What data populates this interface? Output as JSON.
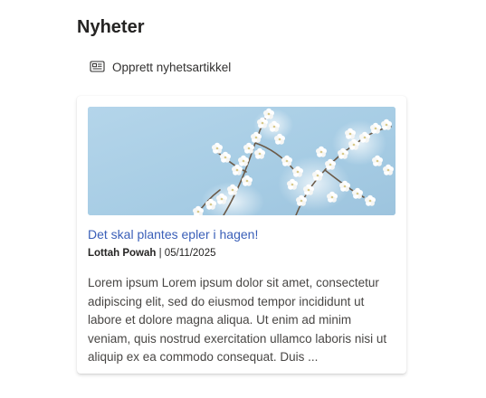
{
  "section": {
    "title": "Nyheter",
    "create_label": "Opprett nyhetsartikkel"
  },
  "card": {
    "image_alt": "Cherry blossoms",
    "title": "Det skal plantes epler i hagen!",
    "author": "Lottah Powah",
    "separator": "|",
    "date": "05/11/2025",
    "excerpt": "Lorem ipsum Lorem ipsum dolor sit amet, consectetur adipiscing elit, sed do eiusmod tempor incididunt ut labore et dolore magna aliqua. Ut enim ad minim veniam, quis nostrud exercitation ullamco laboris nisi ut aliquip ex ea commodo consequat. Duis ..."
  },
  "colors": {
    "link": "#3a5fb8",
    "sky": "#a9cde4",
    "blossom": "#ffffff"
  },
  "icons": {
    "create": "news-article-icon"
  }
}
